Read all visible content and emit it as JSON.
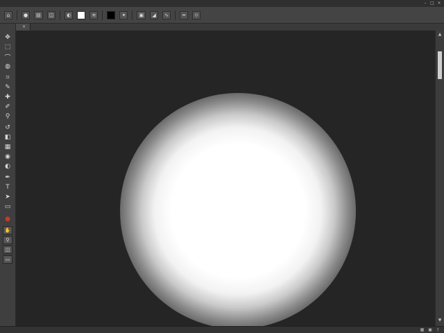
{
  "menubar": {
    "items": [
      "",
      "",
      "",
      "",
      "",
      "",
      "",
      "",
      ""
    ],
    "controls": [
      "–",
      "□",
      "×"
    ]
  },
  "options": {
    "icons": [
      "home-icon",
      "brush-preset-icon",
      "mode-icon",
      "blend-icon",
      "opacity-icon",
      "flow-icon",
      "airbrush-icon",
      "pressure-icon",
      "symmetry-icon"
    ],
    "swatch_fg": "#ffffff",
    "swatch_bg": "#000000"
  },
  "document": {
    "tab_label": "",
    "close_glyph": "×"
  },
  "tools": [
    {
      "name": "move-tool-icon",
      "glyph": "✥"
    },
    {
      "name": "marquee-tool-icon",
      "glyph": "⬚"
    },
    {
      "name": "lasso-tool-icon",
      "glyph": "⌒"
    },
    {
      "name": "quick-select-tool-icon",
      "glyph": "◍"
    },
    {
      "name": "crop-tool-icon",
      "glyph": "⌗"
    },
    {
      "name": "eyedropper-tool-icon",
      "glyph": "✎"
    },
    {
      "name": "healing-tool-icon",
      "glyph": "✚"
    },
    {
      "name": "brush-tool-icon",
      "glyph": "✐"
    },
    {
      "name": "stamp-tool-icon",
      "glyph": "⚲"
    },
    {
      "name": "history-brush-tool-icon",
      "glyph": "↺"
    },
    {
      "name": "eraser-tool-icon",
      "glyph": "◧"
    },
    {
      "name": "gradient-tool-icon",
      "glyph": "▦"
    },
    {
      "name": "blur-tool-icon",
      "glyph": "◉"
    },
    {
      "name": "dodge-tool-icon",
      "glyph": "◐"
    },
    {
      "name": "pen-tool-icon",
      "glyph": "✒"
    },
    {
      "name": "type-tool-icon",
      "glyph": "T"
    },
    {
      "name": "path-select-tool-icon",
      "glyph": "➤"
    },
    {
      "name": "shape-tool-icon",
      "glyph": "▭"
    },
    {
      "name": "hand-tool-icon",
      "glyph": "✋"
    },
    {
      "name": "zoom-tool-icon",
      "glyph": "⚲"
    }
  ],
  "status": {
    "zoom": "",
    "info": "",
    "icons": [
      "arrange-icon",
      "workspace-icon",
      "share-icon"
    ]
  },
  "colors": {
    "canvas_bg": "#252525",
    "ui_bg": "#3a3a3a",
    "glow": "#ffffff",
    "accent_red": "#c23a2a"
  }
}
